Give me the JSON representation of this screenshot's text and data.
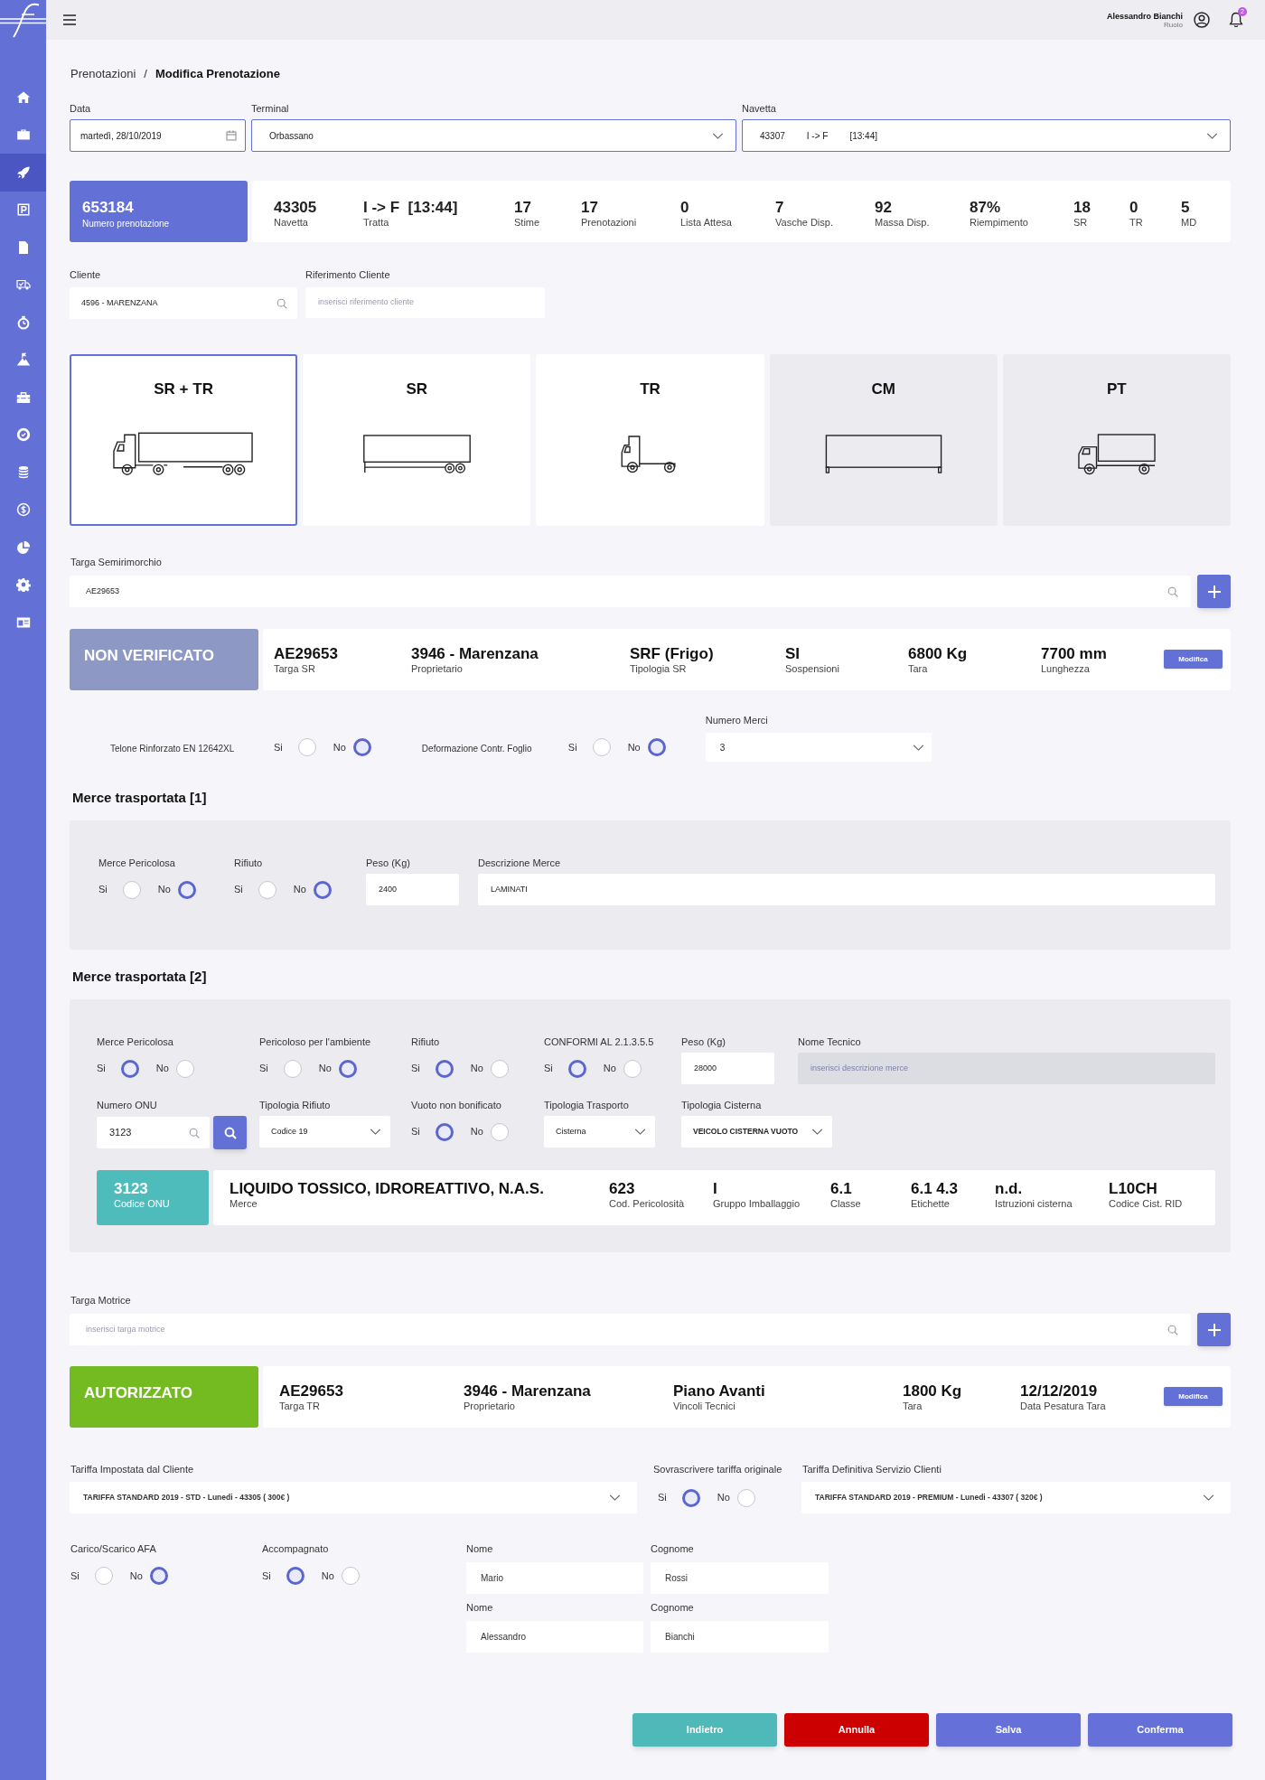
{
  "sidebar": {
    "items": [
      {
        "selected": false
      },
      {
        "selected": false
      },
      {
        "selected": true
      },
      {
        "selected": false
      },
      {
        "selected": false
      },
      {
        "selected": false
      },
      {
        "selected": false
      },
      {
        "selected": false
      },
      {
        "selected": false
      },
      {
        "selected": false
      },
      {
        "selected": false
      },
      {
        "selected": false
      },
      {
        "selected": false
      },
      {
        "selected": false
      },
      {
        "selected": false
      }
    ]
  },
  "header": {
    "user_name": "Alessandro Bianchi",
    "user_role": "Ruolo",
    "notification_count": "2"
  },
  "breadcrumb": {
    "separator": "/",
    "items": [
      {
        "label": "Prenotazioni",
        "current": false
      },
      {
        "label": "Modifica Prenotazione",
        "current": true
      }
    ]
  },
  "selectors": [
    {
      "kind": "date",
      "label": "Data",
      "values": [
        "martedì, 28/10/2019"
      ]
    },
    {
      "kind": "select",
      "label": "Terminal",
      "values": [
        "Orbassano"
      ]
    },
    {
      "kind": "select",
      "label": "Navetta",
      "values": [
        "43307",
        "I -> F",
        "[13:44]"
      ]
    }
  ],
  "booking": {
    "number": "653184",
    "number_label": "Numero prenotazione",
    "stats": [
      {
        "value": "43305",
        "label": "Navetta"
      },
      {
        "value": "I -> F  [13:44]",
        "label": "Tratta"
      },
      {
        "value": "17",
        "label": "Stime"
      },
      {
        "value": "17",
        "label": "Prenotazioni"
      },
      {
        "value": "0",
        "label": "Lista Attesa"
      },
      {
        "value": "7",
        "label": "Vasche Disp."
      },
      {
        "value": "92",
        "label": "Massa Disp."
      },
      {
        "value": "87%",
        "label": "Riempimento"
      },
      {
        "value": "18",
        "label": "SR"
      },
      {
        "value": "0",
        "label": "TR"
      },
      {
        "value": "5",
        "label": "MD"
      }
    ]
  },
  "client": {
    "fields": [
      {
        "kind": "search",
        "label": "Cliente",
        "value": "4596 - MARENZANA"
      },
      {
        "kind": "text",
        "label": "Riferimento Cliente",
        "placeholder": "inserisci riferimento cliente"
      }
    ]
  },
  "vehicle_types": [
    {
      "label": "SR + TR",
      "selected": true,
      "disabled": false
    },
    {
      "label": "SR",
      "selected": false,
      "disabled": false
    },
    {
      "label": "TR",
      "selected": false,
      "disabled": false
    },
    {
      "label": "CM",
      "selected": false,
      "disabled": true
    },
    {
      "label": "PT",
      "selected": false,
      "disabled": true
    }
  ],
  "semitrailer": {
    "plate_field": {
      "label": "Targa Semirimorchio",
      "value": "AE29653"
    },
    "authorized": false,
    "status_label": "NON VERIFICATO",
    "details": [
      {
        "value": "AE29653",
        "label": "Targa SR"
      },
      {
        "value": "3946 - Marenzana",
        "label": "Proprietario"
      },
      {
        "value": "SRF (Frigo)",
        "label": "Tipologia SR"
      },
      {
        "value": "SI",
        "label": "Sospensioni"
      },
      {
        "value": "6800 Kg",
        "label": "Tara"
      },
      {
        "value": "7700 mm",
        "label": "Lunghezza"
      }
    ],
    "edit_button": "Modifica"
  },
  "semitrailer_checks": [
    {
      "label": "Telone Rinforzato EN 12642XL",
      "options": [
        {
          "label": "Si",
          "selected": false
        },
        {
          "label": "No",
          "selected": true
        }
      ]
    },
    {
      "label": "Deformazione Contr. Foglio",
      "options": [
        {
          "label": "Si",
          "selected": false
        },
        {
          "label": "No",
          "selected": true
        }
      ]
    }
  ],
  "goods_count": {
    "label": "Numero Merci",
    "value": "3"
  },
  "goods": [
    {
      "title": "Merce trasportata [1]",
      "rows": [
        [
          {
            "kind": "radio",
            "label": "Merce Pericolosa",
            "options": [
              {
                "label": "Si",
                "selected": false
              },
              {
                "label": "No",
                "selected": true
              }
            ]
          },
          {
            "kind": "radio",
            "label": "Rifiuto",
            "options": [
              {
                "label": "Si",
                "selected": false
              },
              {
                "label": "No",
                "selected": true
              }
            ]
          },
          {
            "kind": "input",
            "label": "Peso (Kg)",
            "value": "2400",
            "disabled": false
          },
          {
            "kind": "input",
            "label": "Descrizione Merce",
            "value": "LAMINATI",
            "disabled": false
          }
        ]
      ]
    },
    {
      "title": "Merce trasportata [2]",
      "rows": [
        [
          {
            "kind": "radio",
            "label": "Merce Pericolosa",
            "options": [
              {
                "label": "Si",
                "selected": true
              },
              {
                "label": "No",
                "selected": false
              }
            ]
          },
          {
            "kind": "radio",
            "label": "Pericoloso per l'ambiente",
            "options": [
              {
                "label": "Si",
                "selected": false
              },
              {
                "label": "No",
                "selected": true
              }
            ]
          },
          {
            "kind": "radio",
            "label": "Rifiuto",
            "options": [
              {
                "label": "Si",
                "selected": true
              },
              {
                "label": "No",
                "selected": false
              }
            ]
          },
          {
            "kind": "radio",
            "label": "CONFORMI AL 2.1.3.5.5",
            "options": [
              {
                "label": "Si",
                "selected": true
              },
              {
                "label": "No",
                "selected": false
              }
            ]
          },
          {
            "kind": "input",
            "label": "Peso (Kg)",
            "value": "28000",
            "disabled": false
          },
          {
            "kind": "input",
            "label": "Nome Tecnico",
            "placeholder": "inserisci descrizione merce",
            "disabled": true
          }
        ],
        [
          {
            "kind": "search",
            "label": "Numero ONU",
            "value": "3123",
            "search_button": true
          },
          {
            "kind": "select",
            "label": "Tipologia Rifiuto",
            "value": "Codice 19"
          },
          {
            "kind": "radio",
            "label": "Vuoto non bonificato",
            "options": [
              {
                "label": "Si",
                "selected": true
              },
              {
                "label": "No",
                "selected": false
              }
            ]
          },
          {
            "kind": "select",
            "label": "Tipologia Trasporto",
            "value": "Cisterna"
          },
          {
            "kind": "select",
            "label": "Tipologia Cisterna",
            "value": "VEICOLO CISTERNA VUOTO"
          }
        ]
      ],
      "un_info": {
        "code": "3123",
        "code_label": "Codice ONU",
        "details": [
          {
            "value": "LIQUIDO TOSSICO, IDROREATTIVO, N.A.S.",
            "label": "Merce"
          },
          {
            "value": "623",
            "label": "Cod. Pericolosità"
          },
          {
            "value": "I",
            "label": "Gruppo Imballaggio"
          },
          {
            "value": "6.1",
            "label": "Classe"
          },
          {
            "value": "6.1 4.3",
            "label": "Etichette"
          },
          {
            "value": "n.d.",
            "label": "Istruzioni cisterna"
          },
          {
            "value": "L10CH",
            "label": "Codice Cist. RID"
          }
        ]
      }
    }
  ],
  "tractor": {
    "plate_field": {
      "label": "Targa Motrice",
      "placeholder": "inserisci targa motrice"
    },
    "authorized": true,
    "status_label": "AUTORIZZATO",
    "details": [
      {
        "value": "AE29653",
        "label": "Targa TR"
      },
      {
        "value": "3946 - Marenzana",
        "label": "Proprietario"
      },
      {
        "value": "Piano Avanti",
        "label": "Vincoli Tecnici"
      },
      {
        "value": "1800 Kg",
        "label": "Tara"
      },
      {
        "value": "12/12/2019",
        "label": "Data Pesatura Tara"
      }
    ],
    "edit_button": "Modifica"
  },
  "tariffs": {
    "client_tariff": {
      "label": "Tariffa Impostata dal Cliente",
      "value": "TARIFFA STANDARD 2019 - STD - Lunedi - 43305 ( 300€ )"
    },
    "override": {
      "label": "Sovrascrivere tariffa originale",
      "options": [
        {
          "label": "Si",
          "selected": true
        },
        {
          "label": "No",
          "selected": false
        }
      ]
    },
    "final_tariff": {
      "label": "Tariffa Definitiva Servizio Clienti",
      "value": "TARIFFA STANDARD 2019 - PREMIUM - Lunedi - 43307 ( 320€ )"
    }
  },
  "service_flags": [
    {
      "label": "Carico/Scarico AFA",
      "options": [
        {
          "label": "Si",
          "selected": false
        },
        {
          "label": "No",
          "selected": true
        }
      ]
    },
    {
      "label": "Accompagnato",
      "options": [
        {
          "label": "Si",
          "selected": true
        },
        {
          "label": "No",
          "selected": false
        }
      ]
    }
  ],
  "people": [
    {
      "first_name_label": "Nome",
      "first_name": "Mario",
      "last_name_label": "Cognome",
      "last_name": "Rossi"
    },
    {
      "first_name_label": "Nome",
      "first_name": "Alessandro",
      "last_name_label": "Cognome",
      "last_name": "Bianchi"
    }
  ],
  "actions": [
    {
      "kind": "back",
      "label": "Indietro"
    },
    {
      "kind": "cancel",
      "label": "Annulla"
    },
    {
      "kind": "save",
      "label": "Salva"
    },
    {
      "kind": "confirm",
      "label": "Conferma"
    }
  ]
}
